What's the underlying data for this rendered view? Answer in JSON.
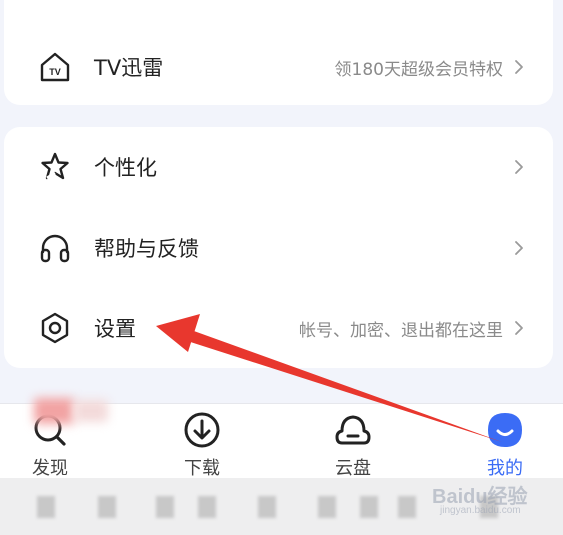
{
  "colors": {
    "accent": "#3b6cf5",
    "annotation_arrow": "#e8372e",
    "background": "#f2f4fb"
  },
  "top_card": {
    "rows": [
      {
        "icon": "tv-house-icon",
        "label": "TV迅雷",
        "hint": "领180天超级会员特权"
      }
    ]
  },
  "settings_card": {
    "rows": [
      {
        "icon": "star-personalize-icon",
        "label": "个性化",
        "hint": ""
      },
      {
        "icon": "headphones-icon",
        "label": "帮助与反馈",
        "hint": ""
      },
      {
        "icon": "hexagon-settings-icon",
        "label": "设置",
        "hint": "帐号、加密、退出都在这里"
      }
    ]
  },
  "bottom_nav": {
    "tabs": [
      {
        "icon": "search-discover-icon",
        "label": "发现",
        "active": false
      },
      {
        "icon": "download-icon",
        "label": "下载",
        "active": false
      },
      {
        "icon": "cloud-icon",
        "label": "云盘",
        "active": false
      },
      {
        "icon": "profile-face-icon",
        "label": "我的",
        "active": true
      }
    ]
  },
  "watermark": {
    "brand": "Baidu经验",
    "sub": "jingyan.baidu.com"
  }
}
